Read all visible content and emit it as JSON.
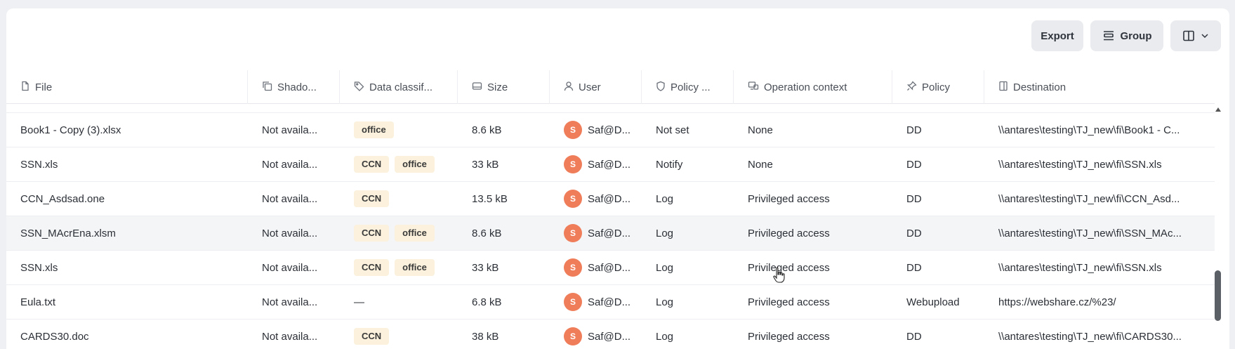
{
  "toolbar": {
    "export_label": "Export",
    "group_label": "Group",
    "columns_icon": "columns-icon"
  },
  "columns": [
    {
      "label": "File",
      "icon": "file-icon"
    },
    {
      "label": "Shado...",
      "icon": "copy-icon"
    },
    {
      "label": "Data classif...",
      "icon": "tag-icon"
    },
    {
      "label": "Size",
      "icon": "drive-icon"
    },
    {
      "label": "User",
      "icon": "user-icon"
    },
    {
      "label": "Policy ...",
      "icon": "shield-icon"
    },
    {
      "label": "Operation context",
      "icon": "monitor-icon"
    },
    {
      "label": "Policy",
      "icon": "pin-icon"
    },
    {
      "label": "Destination",
      "icon": "destination-icon"
    }
  ],
  "rows": [
    {
      "file": "Book1 - Copy (3).xlsx",
      "shadow": "Not availa...",
      "tags": [
        "office"
      ],
      "size": "8.6 kB",
      "user_initial": "S",
      "user": "Saf@D...",
      "policy_action": "Not set",
      "context": "None",
      "policy": "DD",
      "destination": "\\\\antares\\testing\\TJ_new\\fi\\Book1 - C..."
    },
    {
      "file": "SSN.xls",
      "shadow": "Not availa...",
      "tags": [
        "CCN",
        "office"
      ],
      "size": "33 kB",
      "user_initial": "S",
      "user": "Saf@D...",
      "policy_action": "Notify",
      "context": "None",
      "policy": "DD",
      "destination": "\\\\antares\\testing\\TJ_new\\fi\\SSN.xls"
    },
    {
      "file": "CCN_Asdsad.one",
      "shadow": "Not availa...",
      "tags": [
        "CCN"
      ],
      "size": "13.5 kB",
      "user_initial": "S",
      "user": "Saf@D...",
      "policy_action": "Log",
      "context": "Privileged access",
      "policy": "DD",
      "destination": "\\\\antares\\testing\\TJ_new\\fi\\CCN_Asd..."
    },
    {
      "file": "SSN_MAcrEna.xlsm",
      "shadow": "Not availa...",
      "tags": [
        "CCN",
        "office"
      ],
      "size": "8.6 kB",
      "user_initial": "S",
      "user": "Saf@D...",
      "policy_action": "Log",
      "context": "Privileged access",
      "policy": "DD",
      "destination": "\\\\antares\\testing\\TJ_new\\fi\\SSN_MAc..."
    },
    {
      "file": "SSN.xls",
      "shadow": "Not availa...",
      "tags": [
        "CCN",
        "office"
      ],
      "size": "33 kB",
      "user_initial": "S",
      "user": "Saf@D...",
      "policy_action": "Log",
      "context": "Privileged access",
      "policy": "DD",
      "destination": "\\\\antares\\testing\\TJ_new\\fi\\SSN.xls"
    },
    {
      "file": "Eula.txt",
      "shadow": "Not availa...",
      "tags": [],
      "no_tag": "—",
      "size": "6.8 kB",
      "user_initial": "S",
      "user": "Saf@D...",
      "policy_action": "Log",
      "context": "Privileged access",
      "policy": "Webupload",
      "destination": "https://webshare.cz/%23/"
    },
    {
      "file": "CARDS30.doc",
      "shadow": "Not availa...",
      "tags": [
        "CCN"
      ],
      "size": "38 kB",
      "user_initial": "S",
      "user": "Saf@D...",
      "policy_action": "Log",
      "context": "Privileged access",
      "policy": "DD",
      "destination": "\\\\antares\\testing\\TJ_new\\fi\\CARDS30..."
    }
  ],
  "colors": {
    "tag_bg": "#fbf1dc",
    "avatar_bg": "#f07d5a",
    "toolbar_btn_bg": "#e9ebef"
  }
}
